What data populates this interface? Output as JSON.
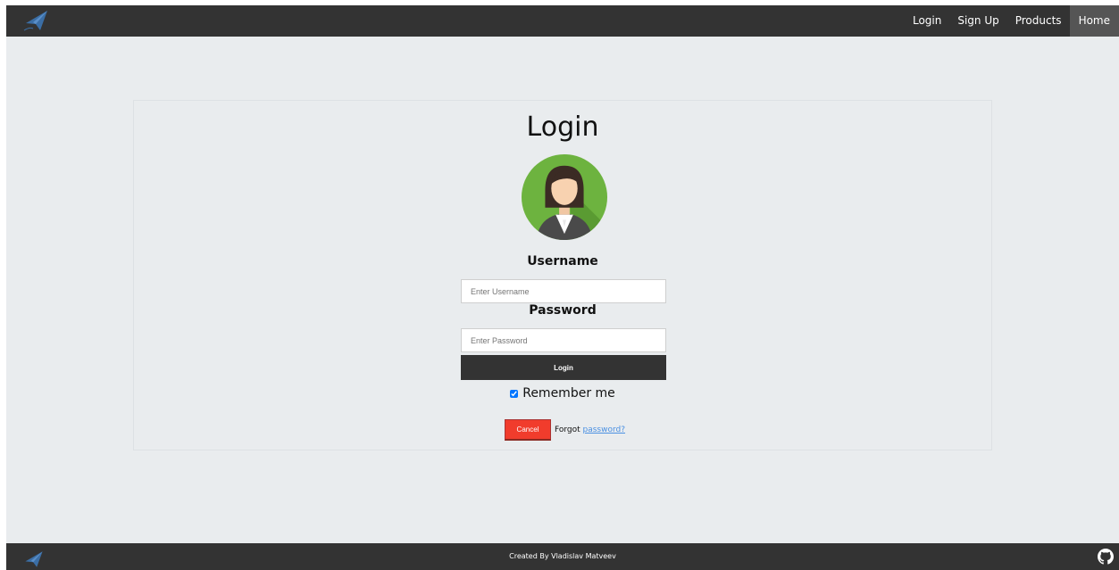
{
  "nav": {
    "items": [
      {
        "label": "Login"
      },
      {
        "label": "Sign Up"
      },
      {
        "label": "Products"
      },
      {
        "label": "Home",
        "active": true
      }
    ]
  },
  "login": {
    "title": "Login",
    "username_label": "Username",
    "username_placeholder": "Enter Username",
    "password_label": "Password",
    "password_placeholder": "Enter Password",
    "submit_label": "Login",
    "remember_label": "Remember me",
    "remember_checked": true,
    "cancel_label": "Cancel",
    "forgot_prefix": "Forgot ",
    "forgot_link": "password?"
  },
  "footer": {
    "text": "Created By Vladislav Matveev"
  },
  "colors": {
    "bar": "#333333",
    "background": "#e9ecee",
    "cancel": "#f13c2c",
    "link": "#4a90e2",
    "avatar_bg": "#6db33f"
  },
  "icons": {
    "logo": "paper-plane-icon",
    "avatar": "user-avatar-icon",
    "github": "github-icon"
  }
}
